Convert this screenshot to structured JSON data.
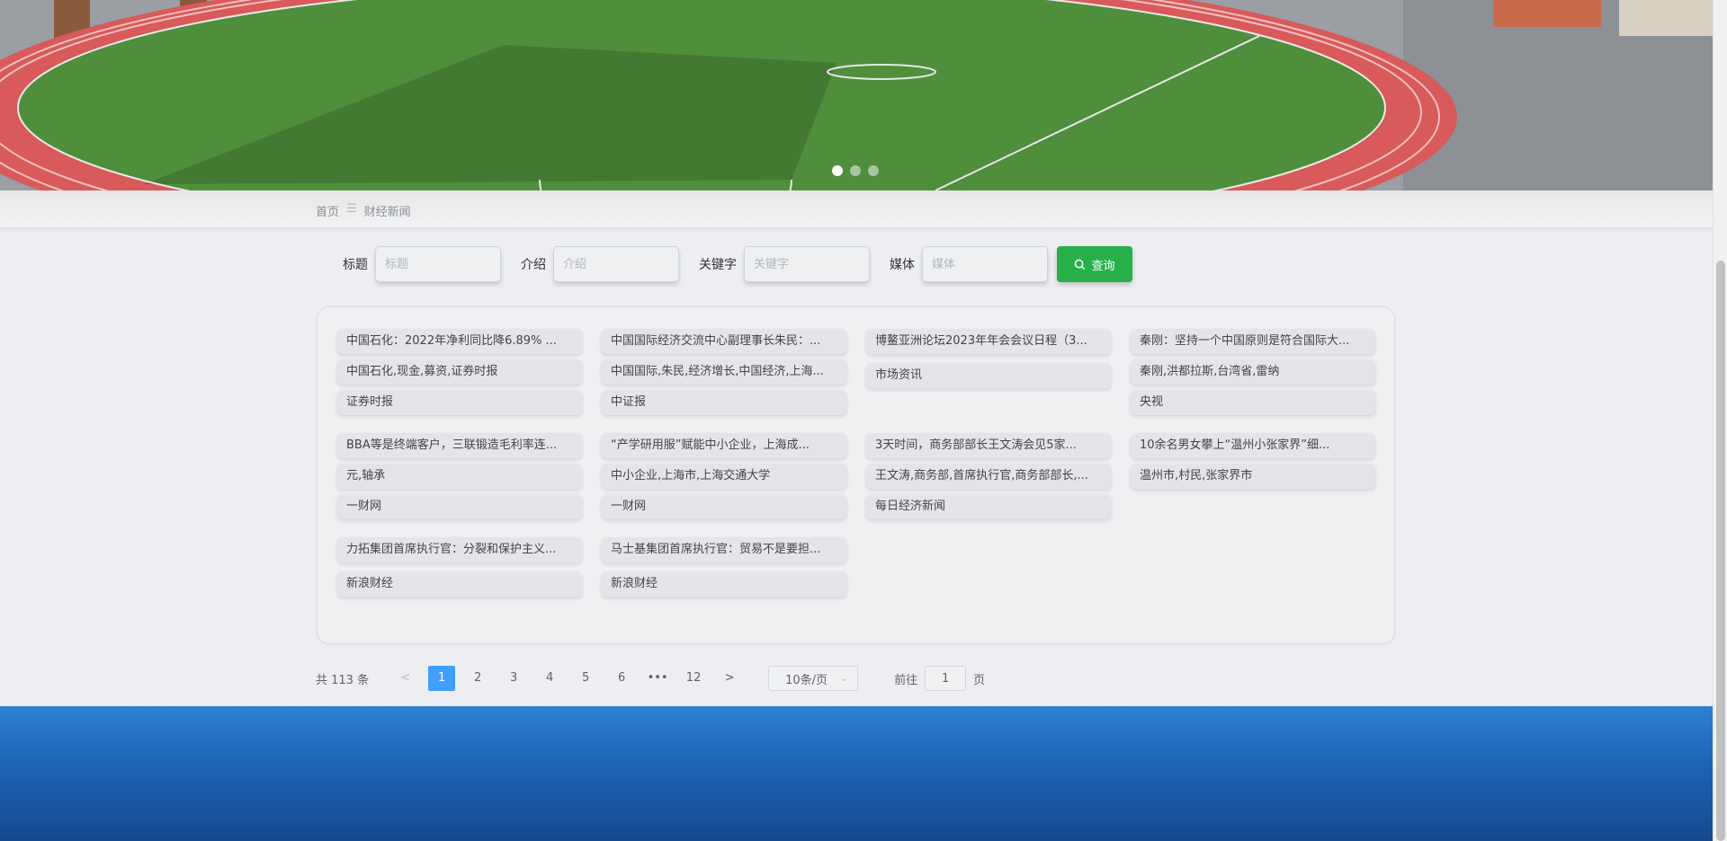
{
  "banner": {
    "slide_count": 3,
    "active_slide": 1
  },
  "breadcrumb": {
    "home": "首页",
    "separator": "☰",
    "current": "财经新闻"
  },
  "search": {
    "fields": [
      {
        "label": "标题",
        "placeholder": "标题"
      },
      {
        "label": "介绍",
        "placeholder": "介绍"
      },
      {
        "label": "关键字",
        "placeholder": "关键字"
      },
      {
        "label": "媒体",
        "placeholder": "媒体"
      }
    ],
    "button_label": "查询"
  },
  "news": [
    {
      "title": "中国石化：2022年净利同比降6.89% ...",
      "keywords": "中国石化,现金,募资,证券时报",
      "media": "证券时报"
    },
    {
      "title": "中国国际经济交流中心副理事长朱民：...",
      "keywords": "中国国际,朱民,经济增长,中国经济,上海...",
      "media": "中证报"
    },
    {
      "title": "博鳌亚洲论坛2023年年会会议日程（3...",
      "keywords": "市场资讯",
      "media": ""
    },
    {
      "title": "秦刚：坚持一个中国原则是符合国际大...",
      "keywords": "秦刚,洪都拉斯,台湾省,雷纳",
      "media": "央视"
    },
    {
      "title": "BBA等是终端客户，三联锻造毛利率连...",
      "keywords": "元,轴承",
      "media": "一财网"
    },
    {
      "title": "“产学研用服”赋能中小企业，上海成...",
      "keywords": "中小企业,上海市,上海交通大学",
      "media": "一财网"
    },
    {
      "title": "3天时间，商务部部长王文涛会见5家...",
      "keywords": "王文涛,商务部,首席执行官,商务部部长,...",
      "media": "每日经济新闻"
    },
    {
      "title": "10余名男女攀上“温州小张家界”细...",
      "keywords": "温州市,村民,张家界市",
      "media": ""
    },
    {
      "title": "力拓集团首席执行官：分裂和保护主义...",
      "keywords": "",
      "media": "新浪财经"
    },
    {
      "title": "马士基集团首席执行官：贸易不是要担...",
      "keywords": "",
      "media": "新浪财经"
    }
  ],
  "pagination": {
    "total_text": "共 113 条",
    "prev": "<",
    "next": ">",
    "pages": [
      "1",
      "2",
      "3",
      "4",
      "5",
      "6",
      "•••",
      "12"
    ],
    "current_page": "1",
    "page_size": "10条/页",
    "goto_prefix": "前往",
    "goto_value": "1",
    "goto_suffix": "页"
  }
}
